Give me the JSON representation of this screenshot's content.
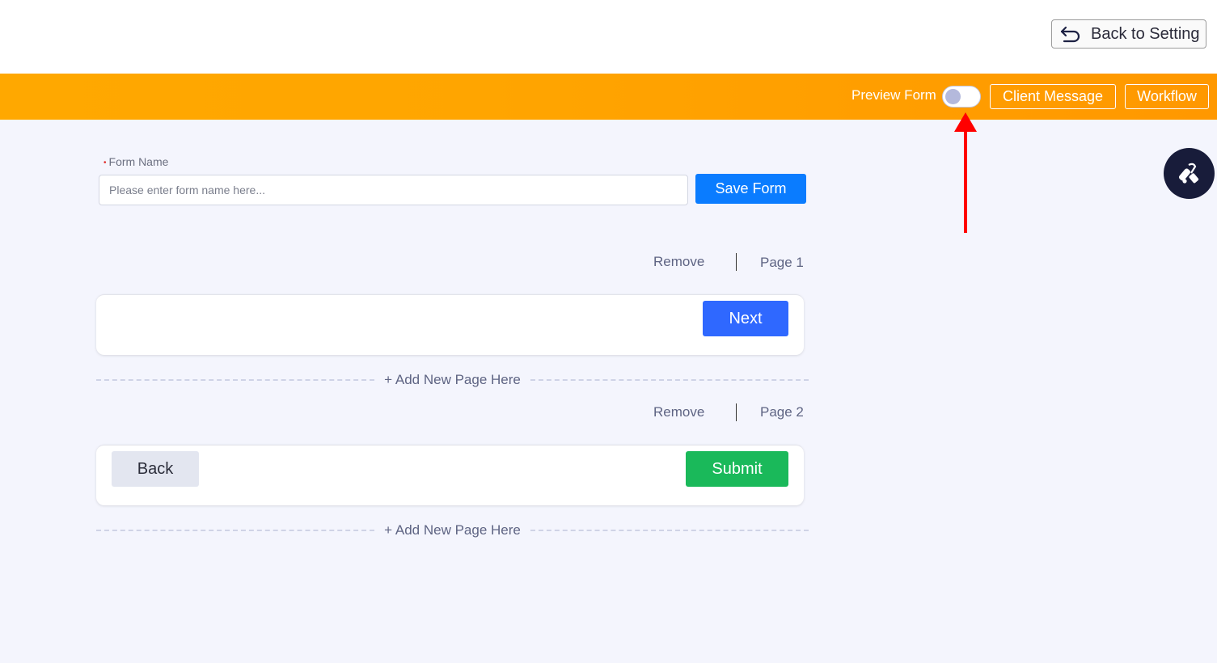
{
  "header": {
    "back_button_label": "Back to Setting",
    "preview_label": "Preview Form",
    "preview_toggle_on": false,
    "client_message_label": "Client Message",
    "workflow_label": "Workflow"
  },
  "form": {
    "name_label": "Form Name",
    "required_marker": "•",
    "name_placeholder": "Please enter form name here...",
    "name_value": "",
    "save_label": "Save Form"
  },
  "pages": [
    {
      "remove_label": "Remove",
      "page_label": "Page 1",
      "buttons": {
        "next": "Next"
      }
    },
    {
      "remove_label": "Remove",
      "page_label": "Page 2",
      "buttons": {
        "back": "Back",
        "submit": "Submit"
      }
    }
  ],
  "add_page_label": "+ Add New Page Here",
  "annotation": {
    "type": "red-arrow",
    "target": "preview-toggle"
  },
  "colors": {
    "orange_bar": "#ffa500",
    "save_button": "#0a7cff",
    "next_button": "#2f68ff",
    "submit_button": "#1ab95a",
    "back_button": "#e3e6f0",
    "arrow": "#ff0000",
    "float_button": "#181c3a"
  }
}
